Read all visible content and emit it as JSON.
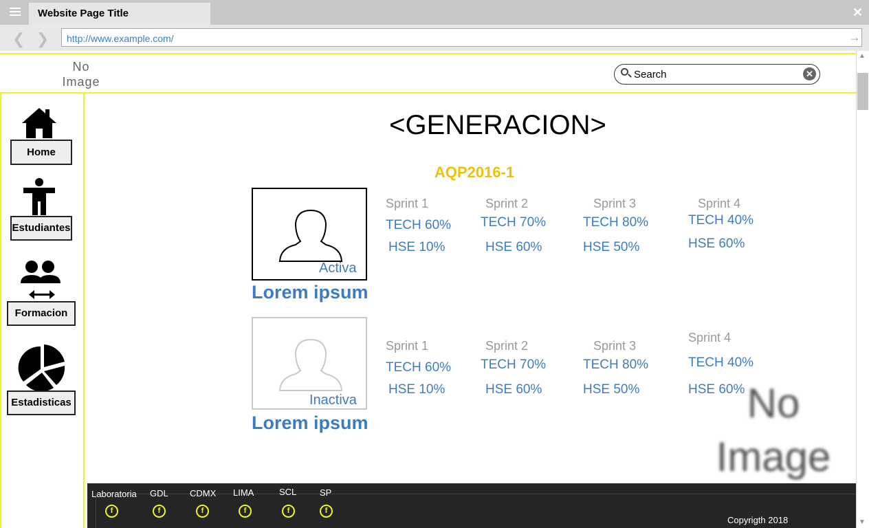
{
  "browser": {
    "tab_title": "Website Page Title",
    "url": "http://www.example.com/",
    "close_glyph": "✕",
    "back_glyph": "❮",
    "forward_glyph": "❯",
    "go_glyph": "→"
  },
  "header": {
    "logo_text": "No Image",
    "search": {
      "value": "Search",
      "placeholder": "Search"
    },
    "clear_glyph": "✕"
  },
  "sidebar": {
    "items": [
      {
        "label": "Home",
        "icon": "home-icon"
      },
      {
        "label": "Estudiantes",
        "icon": "person-icon"
      },
      {
        "label": "Formacion",
        "icon": "group-exchange-icon"
      },
      {
        "label": "Estadisticas",
        "icon": "pie-chart-icon"
      }
    ]
  },
  "main": {
    "title": "<GENERACION>",
    "generation_code": "AQP2016-1",
    "students": [
      {
        "name": "Lorem ipsum",
        "status": "Activa",
        "sprints": [
          {
            "label": "Sprint 1",
            "tech": "TECH 60%",
            "hse": "HSE 10%"
          },
          {
            "label": "Sprint 2",
            "tech": "TECH 70%",
            "hse": "HSE 60%"
          },
          {
            "label": "Sprint 3",
            "tech": "TECH 80%",
            "hse": "HSE 50%"
          },
          {
            "label": "Sprint 4",
            "tech": "TECH 40%",
            "hse": "HSE 60%"
          }
        ]
      },
      {
        "name": "Lorem ipsum",
        "status": "Inactiva",
        "sprints": [
          {
            "label": "Sprint 1",
            "tech": "TECH 60%",
            "hse": "HSE 10%"
          },
          {
            "label": "Sprint 2",
            "tech": "TECH 70%",
            "hse": "HSE 60%"
          },
          {
            "label": "Sprint 3",
            "tech": "TECH 80%",
            "hse": "HSE 50%"
          },
          {
            "label": "Sprint 4",
            "tech": "TECH 40%",
            "hse": "HSE 60%"
          }
        ]
      }
    ],
    "image_placeholder": "No Image"
  },
  "footer": {
    "cities": [
      "Laboratoria",
      "GDL",
      "CDMX",
      "LIMA",
      "SCL",
      "SP"
    ],
    "facebook_glyph": "f",
    "copyright": "Copyrigth 2018"
  },
  "colors": {
    "accent_blue": "#3d7cc4",
    "accent_yellow": "#f2c200",
    "border_yellow": "#f2f22a",
    "footer_bg": "#252525"
  }
}
